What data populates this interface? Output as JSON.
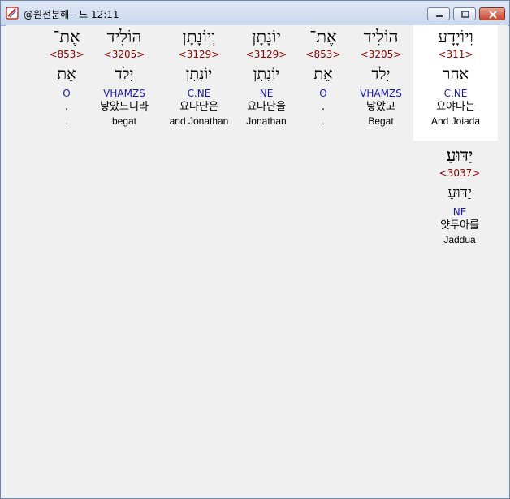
{
  "window": {
    "title": "@원전분해 - 느 12:11"
  },
  "words_row1": [
    {
      "hebrew": "וִיוֹיָדָע",
      "strong": "<311>",
      "root": "אַחַר",
      "grammar": "C.NE",
      "korean": "요야다는",
      "english": "And Joiada",
      "selected": true
    },
    {
      "hebrew": "הוֹלִיד",
      "strong": "<3205>",
      "root": "יָלַד",
      "grammar": "VHAMZS",
      "korean": "낳았고",
      "english": "Begat",
      "selected": false
    },
    {
      "hebrew": "אֶת־",
      "strong": "<853>",
      "root": "אֵת",
      "grammar": "O",
      "korean": ".",
      "english": ".",
      "selected": false
    },
    {
      "hebrew": "יוֹנָתָן",
      "strong": "<3129>",
      "root": "יוֹנָתָן",
      "grammar": "NE",
      "korean": "요나단을",
      "english": "Jonathan",
      "selected": false
    },
    {
      "hebrew": "וְיוֹנָתָן",
      "strong": "<3129>",
      "root": "יוֹנָתָן",
      "grammar": "C.NE",
      "korean": "요나단은",
      "english": "and Jonathan",
      "selected": false
    },
    {
      "hebrew": "הוֹלִיד",
      "strong": "<3205>",
      "root": "יָלַד",
      "grammar": "VHAMZS",
      "korean": "낳았느니라",
      "english": "begat",
      "selected": false
    },
    {
      "hebrew": "אֶת־",
      "strong": "<853>",
      "root": "אֵת",
      "grammar": "O",
      "korean": ".",
      "english": ".",
      "selected": false
    }
  ],
  "words_row2": [
    {
      "hebrew": "יַדּוּעַ׃",
      "strong": "<3037>",
      "root": "יַדּוּעַ",
      "grammar": "NE",
      "korean": "얏두아를",
      "english": "Jaddua",
      "selected": false
    }
  ],
  "colors": {
    "strong": "#8b0000",
    "grammar": "#1a1aa8",
    "selected_bg": "#ffffff",
    "panel_bg": "#f0f0f0"
  }
}
